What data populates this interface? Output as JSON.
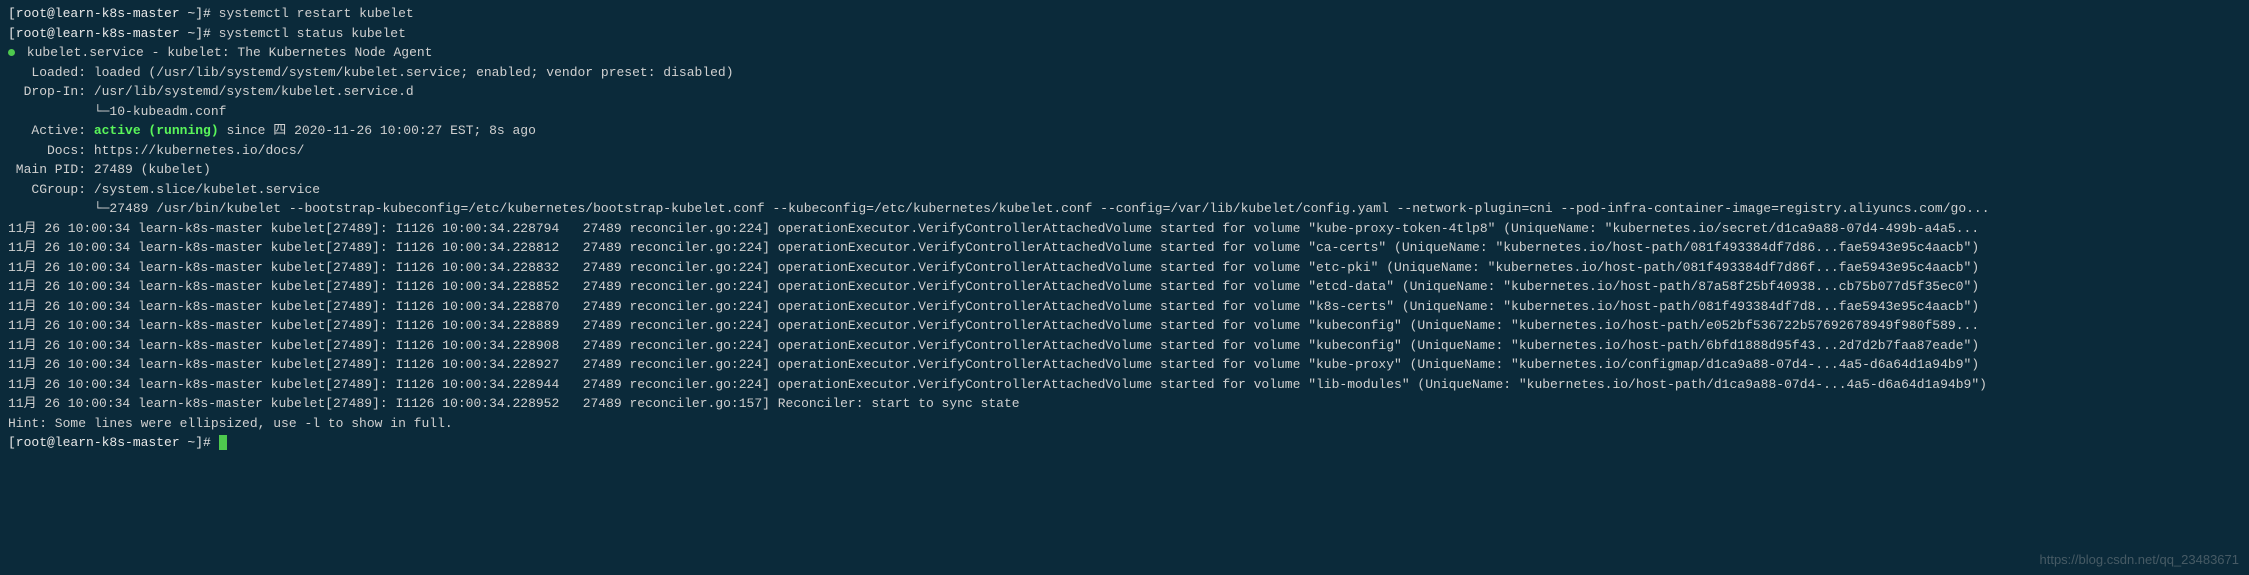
{
  "prompt1": "[root@learn-k8s-master ~]# ",
  "cmd1": "systemctl restart kubelet",
  "prompt2": "[root@learn-k8s-master ~]# ",
  "cmd2": "systemctl status kubelet",
  "service_line_prefix": " kubelet.service - kubelet: The Kubernetes Node Agent",
  "loaded": "   Loaded: loaded (/usr/lib/systemd/system/kubelet.service; enabled; vendor preset: disabled)",
  "dropin1": "  Drop-In: /usr/lib/systemd/system/kubelet.service.d",
  "dropin2": "           └─10-kubeadm.conf",
  "active_prefix": "   Active: ",
  "active_status": "active (running)",
  "active_suffix": " since 四 2020-11-26 10:00:27 EST; 8s ago",
  "docs": "     Docs: https://kubernetes.io/docs/",
  "mainpid": " Main PID: 27489 (kubelet)",
  "cgroup1": "   CGroup: /system.slice/kubelet.service",
  "cgroup2": "           └─27489 /usr/bin/kubelet --bootstrap-kubeconfig=/etc/kubernetes/bootstrap-kubelet.conf --kubeconfig=/etc/kubernetes/kubelet.conf --config=/var/lib/kubelet/config.yaml --network-plugin=cni --pod-infra-container-image=registry.aliyuncs.com/go...",
  "blank": "",
  "logs": [
    "11月 26 10:00:34 learn-k8s-master kubelet[27489]: I1126 10:00:34.228794   27489 reconciler.go:224] operationExecutor.VerifyControllerAttachedVolume started for volume \"kube-proxy-token-4tlp8\" (UniqueName: \"kubernetes.io/secret/d1ca9a88-07d4-499b-a4a5...",
    "11月 26 10:00:34 learn-k8s-master kubelet[27489]: I1126 10:00:34.228812   27489 reconciler.go:224] operationExecutor.VerifyControllerAttachedVolume started for volume \"ca-certs\" (UniqueName: \"kubernetes.io/host-path/081f493384df7d86...fae5943e95c4aacb\")",
    "11月 26 10:00:34 learn-k8s-master kubelet[27489]: I1126 10:00:34.228832   27489 reconciler.go:224] operationExecutor.VerifyControllerAttachedVolume started for volume \"etc-pki\" (UniqueName: \"kubernetes.io/host-path/081f493384df7d86f...fae5943e95c4aacb\")",
    "11月 26 10:00:34 learn-k8s-master kubelet[27489]: I1126 10:00:34.228852   27489 reconciler.go:224] operationExecutor.VerifyControllerAttachedVolume started for volume \"etcd-data\" (UniqueName: \"kubernetes.io/host-path/87a58f25bf40938...cb75b077d5f35ec0\")",
    "11月 26 10:00:34 learn-k8s-master kubelet[27489]: I1126 10:00:34.228870   27489 reconciler.go:224] operationExecutor.VerifyControllerAttachedVolume started for volume \"k8s-certs\" (UniqueName: \"kubernetes.io/host-path/081f493384df7d8...fae5943e95c4aacb\")",
    "11月 26 10:00:34 learn-k8s-master kubelet[27489]: I1126 10:00:34.228889   27489 reconciler.go:224] operationExecutor.VerifyControllerAttachedVolume started for volume \"kubeconfig\" (UniqueName: \"kubernetes.io/host-path/e052bf536722b57692678949f980f589...",
    "11月 26 10:00:34 learn-k8s-master kubelet[27489]: I1126 10:00:34.228908   27489 reconciler.go:224] operationExecutor.VerifyControllerAttachedVolume started for volume \"kubeconfig\" (UniqueName: \"kubernetes.io/host-path/6bfd1888d95f43...2d7d2b7faa87eade\")",
    "11月 26 10:00:34 learn-k8s-master kubelet[27489]: I1126 10:00:34.228927   27489 reconciler.go:224] operationExecutor.VerifyControllerAttachedVolume started for volume \"kube-proxy\" (UniqueName: \"kubernetes.io/configmap/d1ca9a88-07d4-...4a5-d6a64d1a94b9\")",
    "11月 26 10:00:34 learn-k8s-master kubelet[27489]: I1126 10:00:34.228944   27489 reconciler.go:224] operationExecutor.VerifyControllerAttachedVolume started for volume \"lib-modules\" (UniqueName: \"kubernetes.io/host-path/d1ca9a88-07d4-...4a5-d6a64d1a94b9\")",
    "11月 26 10:00:34 learn-k8s-master kubelet[27489]: I1126 10:00:34.228952   27489 reconciler.go:157] Reconciler: start to sync state"
  ],
  "hint": "Hint: Some lines were ellipsized, use -l to show in full.",
  "prompt3": "[root@learn-k8s-master ~]# ",
  "watermark": "https://blog.csdn.net/qq_23483671"
}
